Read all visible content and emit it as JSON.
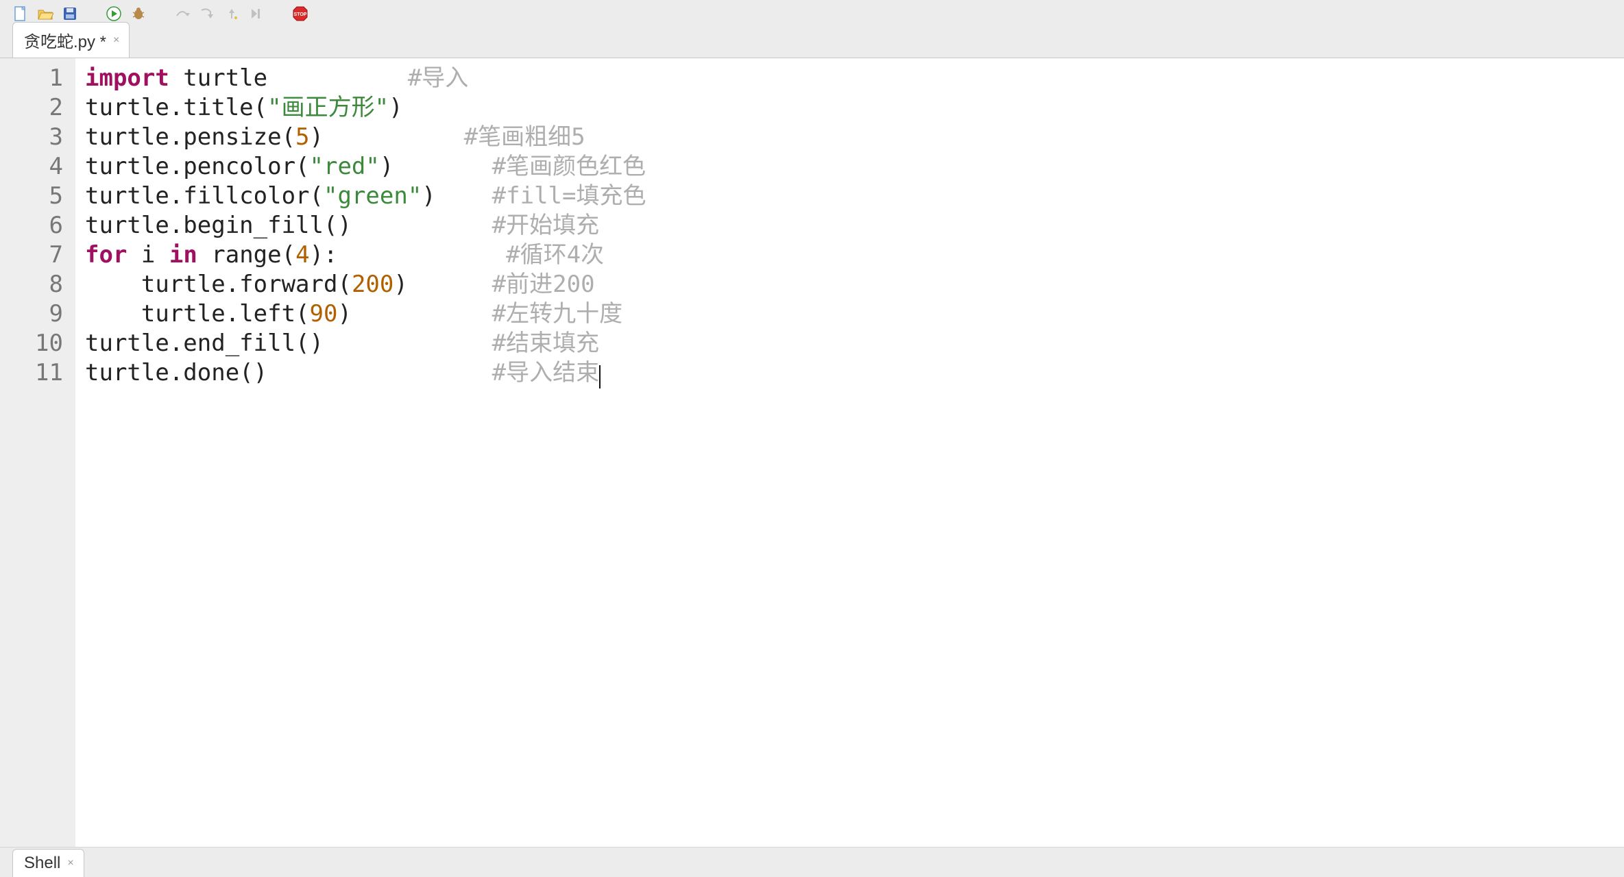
{
  "toolbar": {
    "new_file": "new-file",
    "open_file": "open-file",
    "save_file": "save-file",
    "run": "run",
    "debug": "debug",
    "step_over": "step-over",
    "step_into": "step-into",
    "step_out": "step-out",
    "resume": "resume",
    "stop": "stop"
  },
  "tabs": {
    "editor_tab_label": "贪吃蛇.py *",
    "shell_tab_label": "Shell"
  },
  "code": {
    "line_numbers": [
      "1",
      "2",
      "3",
      "4",
      "5",
      "6",
      "7",
      "8",
      "9",
      "10",
      "11"
    ],
    "lines": [
      {
        "tokens": [
          {
            "t": "import",
            "c": "kw"
          },
          {
            "t": " turtle          ",
            "c": "ident"
          },
          {
            "t": "#导入",
            "c": "comment"
          }
        ]
      },
      {
        "tokens": [
          {
            "t": "turtle.title(",
            "c": "ident"
          },
          {
            "t": "\"画正方形\"",
            "c": "str"
          },
          {
            "t": ")",
            "c": "ident"
          }
        ]
      },
      {
        "tokens": [
          {
            "t": "turtle.pensize(",
            "c": "ident"
          },
          {
            "t": "5",
            "c": "num"
          },
          {
            "t": ")          ",
            "c": "ident"
          },
          {
            "t": "#笔画粗细5",
            "c": "comment"
          }
        ]
      },
      {
        "tokens": [
          {
            "t": "turtle.pencolor(",
            "c": "ident"
          },
          {
            "t": "\"red\"",
            "c": "str"
          },
          {
            "t": ")       ",
            "c": "ident"
          },
          {
            "t": "#笔画颜色红色",
            "c": "comment"
          }
        ]
      },
      {
        "tokens": [
          {
            "t": "turtle.fillcolor(",
            "c": "ident"
          },
          {
            "t": "\"green\"",
            "c": "str"
          },
          {
            "t": ")    ",
            "c": "ident"
          },
          {
            "t": "#fill=填充色",
            "c": "comment"
          }
        ]
      },
      {
        "tokens": [
          {
            "t": "turtle.begin_fill()          ",
            "c": "ident"
          },
          {
            "t": "#开始填充",
            "c": "comment"
          }
        ]
      },
      {
        "tokens": [
          {
            "t": "for",
            "c": "kw"
          },
          {
            "t": " i ",
            "c": "ident"
          },
          {
            "t": "in",
            "c": "kw"
          },
          {
            "t": " range(",
            "c": "ident"
          },
          {
            "t": "4",
            "c": "num"
          },
          {
            "t": "):            ",
            "c": "ident"
          },
          {
            "t": "#循环4次",
            "c": "comment"
          }
        ]
      },
      {
        "tokens": [
          {
            "t": "    turtle.forward(",
            "c": "ident"
          },
          {
            "t": "200",
            "c": "num"
          },
          {
            "t": ")      ",
            "c": "ident"
          },
          {
            "t": "#前进200",
            "c": "comment"
          }
        ]
      },
      {
        "tokens": [
          {
            "t": "    turtle.left(",
            "c": "ident"
          },
          {
            "t": "90",
            "c": "num"
          },
          {
            "t": ")          ",
            "c": "ident"
          },
          {
            "t": "#左转九十度",
            "c": "comment"
          }
        ]
      },
      {
        "tokens": [
          {
            "t": "turtle.end_fill()            ",
            "c": "ident"
          },
          {
            "t": "#结束填充",
            "c": "comment"
          }
        ]
      },
      {
        "tokens": [
          {
            "t": "turtle.done()                ",
            "c": "ident"
          },
          {
            "t": "#导入结束",
            "c": "comment"
          }
        ],
        "cursor_after": true
      }
    ]
  }
}
